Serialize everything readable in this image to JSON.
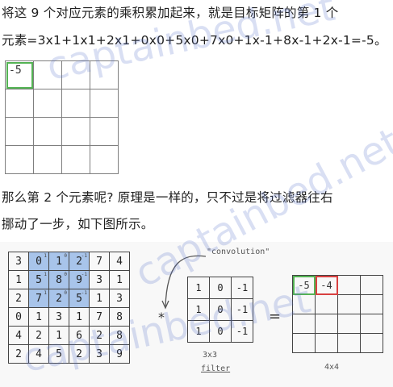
{
  "paragraph1": {
    "line1": "将这 9 个对应元素的乘积累加起来，就是目标矩阵的第 1 个",
    "line2": "元素=3x1+1x1+2x1+0x0+5x0+7x0+1x-1+8x-1+2x-1=-5。"
  },
  "result_grid": {
    "first_value": "-5"
  },
  "paragraph2": {
    "line1": "那么第 2 个元素呢? 原理是一样的，只不过是将过滤器往右",
    "line2": "挪动了一步，如下图所示。"
  },
  "figure": {
    "input": [
      [
        "3",
        "0",
        "1",
        "2",
        "7",
        "4"
      ],
      [
        "1",
        "5",
        "8",
        "9",
        "3",
        "1"
      ],
      [
        "2",
        "7",
        "2",
        "5",
        "1",
        "3"
      ],
      [
        "0",
        "1",
        "3",
        "1",
        "7",
        "8"
      ],
      [
        "4",
        "2",
        "1",
        "6",
        "2",
        "8"
      ],
      [
        "2",
        "4",
        "5",
        "2",
        "3",
        "9"
      ]
    ],
    "input_superscripts": [
      [
        "",
        "1",
        "0",
        "-1",
        "",
        ""
      ],
      [
        "",
        "1",
        "0",
        "-1",
        "",
        ""
      ],
      [
        "",
        "1",
        "0",
        "-1",
        "",
        ""
      ]
    ],
    "convolution_label": "\"convolution\"",
    "operator": "*",
    "filter": [
      [
        "1",
        "0",
        "-1"
      ],
      [
        "1",
        "0",
        "-1"
      ],
      [
        "1",
        "0",
        "-1"
      ]
    ],
    "filter_size_label": "3x3",
    "filter_name_label": "filter",
    "equals": "=",
    "output_values": [
      "-5",
      "-4"
    ],
    "output_size_label": "4x4"
  },
  "watermark": "captainbed.net",
  "colors": {
    "highlight": "#a8c4ea",
    "first_output_border": "#54b354",
    "second_output_border": "#d84040"
  }
}
